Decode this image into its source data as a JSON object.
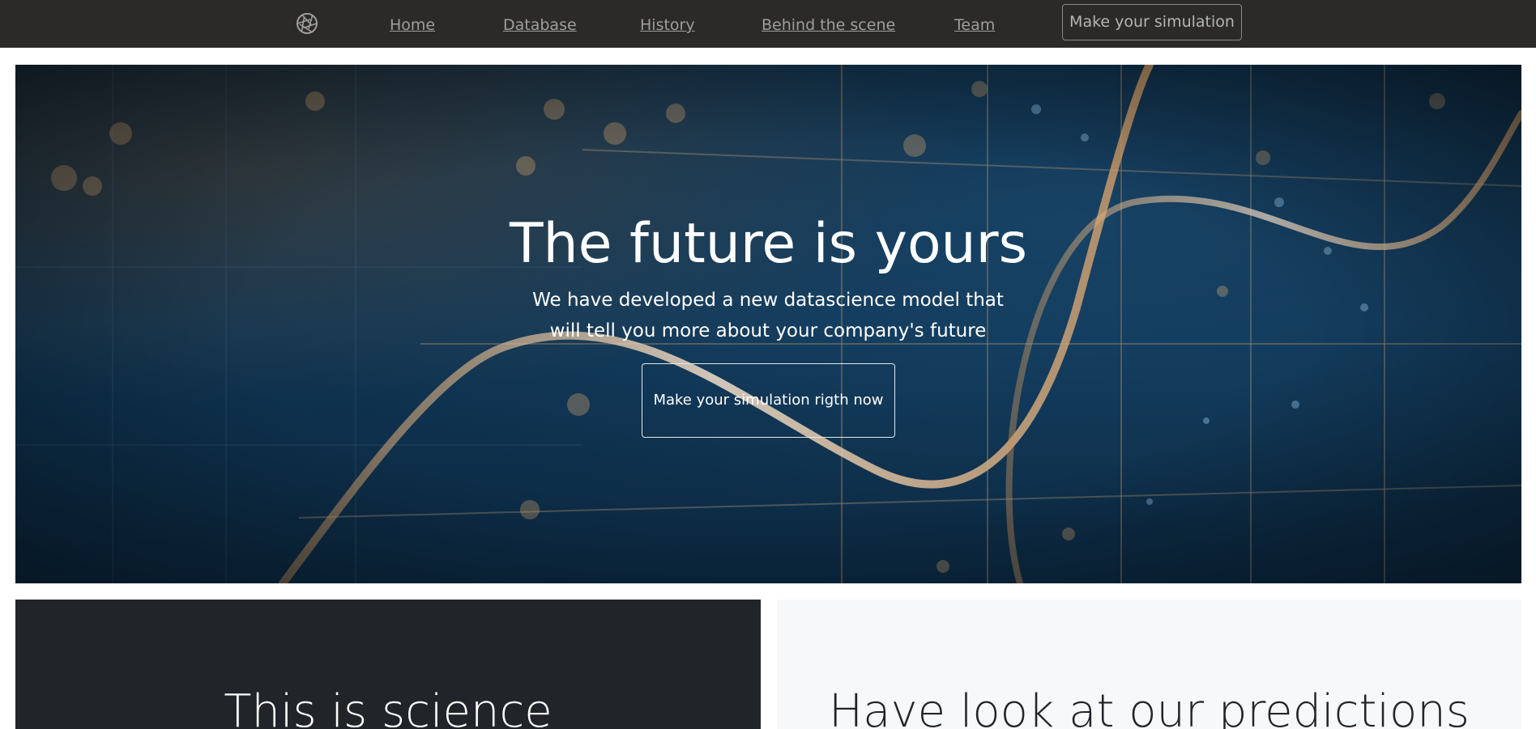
{
  "nav": {
    "logo_icon": "aperture-icon",
    "links": [
      "Home",
      "Database",
      "History",
      "Behind the scene",
      "Team"
    ],
    "cta_label": "Make your simulation"
  },
  "hero": {
    "title": "The future is yours",
    "subtitle": "We have developed a new datascience model that will tell you more about your company's future",
    "cta_label": "Make your simulation rigth now"
  },
  "panels": {
    "science_title": "This is science",
    "predictions_title": "Have look at our predictions"
  },
  "colors": {
    "navbar": "#2b2a28",
    "nav_link": "#9e9e9e",
    "dark_panel": "#212529",
    "light_panel": "#f7f8fa",
    "hero_accent": "#d9b68c"
  }
}
